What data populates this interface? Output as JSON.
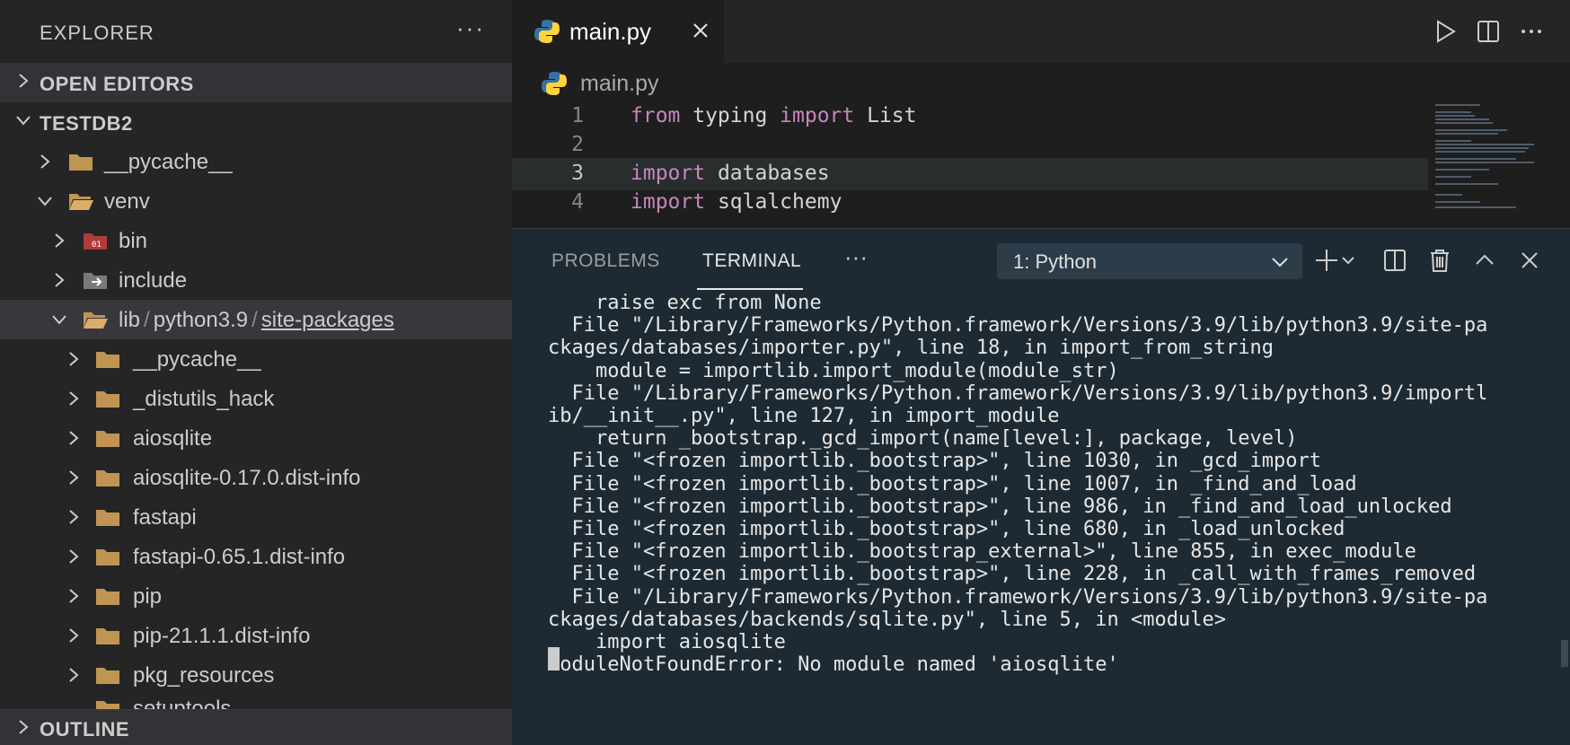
{
  "sidebar": {
    "title": "EXPLORER",
    "more": "···",
    "sections": {
      "open_editors": "OPEN EDITORS",
      "project": "TESTDB2",
      "outline": "OUTLINE"
    },
    "tree": [
      {
        "label": "__pycache__"
      },
      {
        "label": "venv"
      },
      {
        "label": "bin"
      },
      {
        "label": "include"
      },
      {
        "path_parts": [
          "lib",
          "python3.9",
          "site-packages"
        ],
        "separator": "/"
      },
      {
        "label": "__pycache__"
      },
      {
        "label": "_distutils_hack"
      },
      {
        "label": "aiosqlite"
      },
      {
        "label": "aiosqlite-0.17.0.dist-info"
      },
      {
        "label": "fastapi"
      },
      {
        "label": "fastapi-0.65.1.dist-info"
      },
      {
        "label": "pip"
      },
      {
        "label": "pip-21.1.1.dist-info"
      },
      {
        "label": "pkg_resources"
      },
      {
        "label": "setuptools"
      }
    ]
  },
  "editor": {
    "tab": {
      "label": "main.py"
    },
    "breadcrumb": "main.py",
    "code": [
      {
        "num": "1",
        "kw": "from",
        "rest": " typing ",
        "kw2": "import",
        "rest2": " List"
      },
      {
        "num": "2",
        "kw": "",
        "rest": "",
        "kw2": "",
        "rest2": ""
      },
      {
        "num": "3",
        "kw": "import",
        "rest": " databases",
        "kw2": "",
        "rest2": ""
      },
      {
        "num": "4",
        "kw": "import",
        "rest": " sqlalchemy",
        "kw2": "",
        "rest2": ""
      }
    ]
  },
  "panel": {
    "tabs": {
      "problems": "PROBLEMS",
      "terminal": "TERMINAL",
      "more": "···"
    },
    "terminal_select": "1: Python",
    "terminal_output": [
      "    raise exc from None",
      "  File \"/Library/Frameworks/Python.framework/Versions/3.9/lib/python3.9/site-pa",
      "ckages/databases/importer.py\", line 18, in import_from_string",
      "    module = importlib.import_module(module_str)",
      "  File \"/Library/Frameworks/Python.framework/Versions/3.9/lib/python3.9/importl",
      "ib/__init__.py\", line 127, in import_module",
      "    return _bootstrap._gcd_import(name[level:], package, level)",
      "  File \"<frozen importlib._bootstrap>\", line 1030, in _gcd_import",
      "  File \"<frozen importlib._bootstrap>\", line 1007, in _find_and_load",
      "  File \"<frozen importlib._bootstrap>\", line 986, in _find_and_load_unlocked",
      "  File \"<frozen importlib._bootstrap>\", line 680, in _load_unlocked",
      "  File \"<frozen importlib._bootstrap_external>\", line 855, in exec_module",
      "  File \"<frozen importlib._bootstrap>\", line 228, in _call_with_frames_removed",
      "  File \"/Library/Frameworks/Python.framework/Versions/3.9/lib/python3.9/site-pa",
      "ckages/databases/backends/sqlite.py\", line 5, in <module>",
      "    import aiosqlite",
      "ModuleNotFoundError: No module named 'aiosqlite'"
    ]
  },
  "colors": {
    "folder": "#c09553",
    "keyword": "#c586c0",
    "python_blue": "#3572A5",
    "python_yellow": "#FFD43B"
  }
}
